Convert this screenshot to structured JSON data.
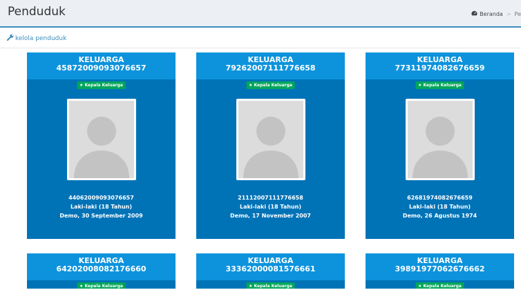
{
  "header": {
    "title": "Penduduk",
    "breadcrumb": {
      "home": "Beranda",
      "current": "Pe"
    }
  },
  "panel": {
    "link_label": "kelola penduduk"
  },
  "cards": [
    {
      "keluarga_label": "KELUARGA",
      "no_kk": "45872009093076657",
      "role": "Kepala Keluarga",
      "nik": "44062009093076657",
      "gender_age": "Laki-laki (18 Tahun)",
      "birth": "Demo, 30 September 2009"
    },
    {
      "keluarga_label": "KELUARGA",
      "no_kk": "79262007111776658",
      "role": "Kepala Keluarga",
      "nik": "21112007111776658",
      "gender_age": "Laki-laki (18 Tahun)",
      "birth": "Demo, 17 November 2007"
    },
    {
      "keluarga_label": "KELUARGA",
      "no_kk": "77311974082676659",
      "role": "Kepala Keluarga",
      "nik": "62681974082676659",
      "gender_age": "Laki-laki (18 Tahun)",
      "birth": "Demo, 26 Agustus 1974"
    },
    {
      "keluarga_label": "KELUARGA",
      "no_kk": "64202008082176660",
      "role": "Kepala Keluarga"
    },
    {
      "keluarga_label": "KELUARGA",
      "no_kk": "33362000081576661",
      "role": "Kepala Keluarga"
    },
    {
      "keluarga_label": "KELUARGA",
      "no_kk": "39891977062676662",
      "role": "Kepala Keluarga"
    }
  ],
  "colors": {
    "card_body": "#0073b7",
    "card_header": "#0d93dc",
    "badge": "#00a65a",
    "link": "#3c8dbc"
  }
}
